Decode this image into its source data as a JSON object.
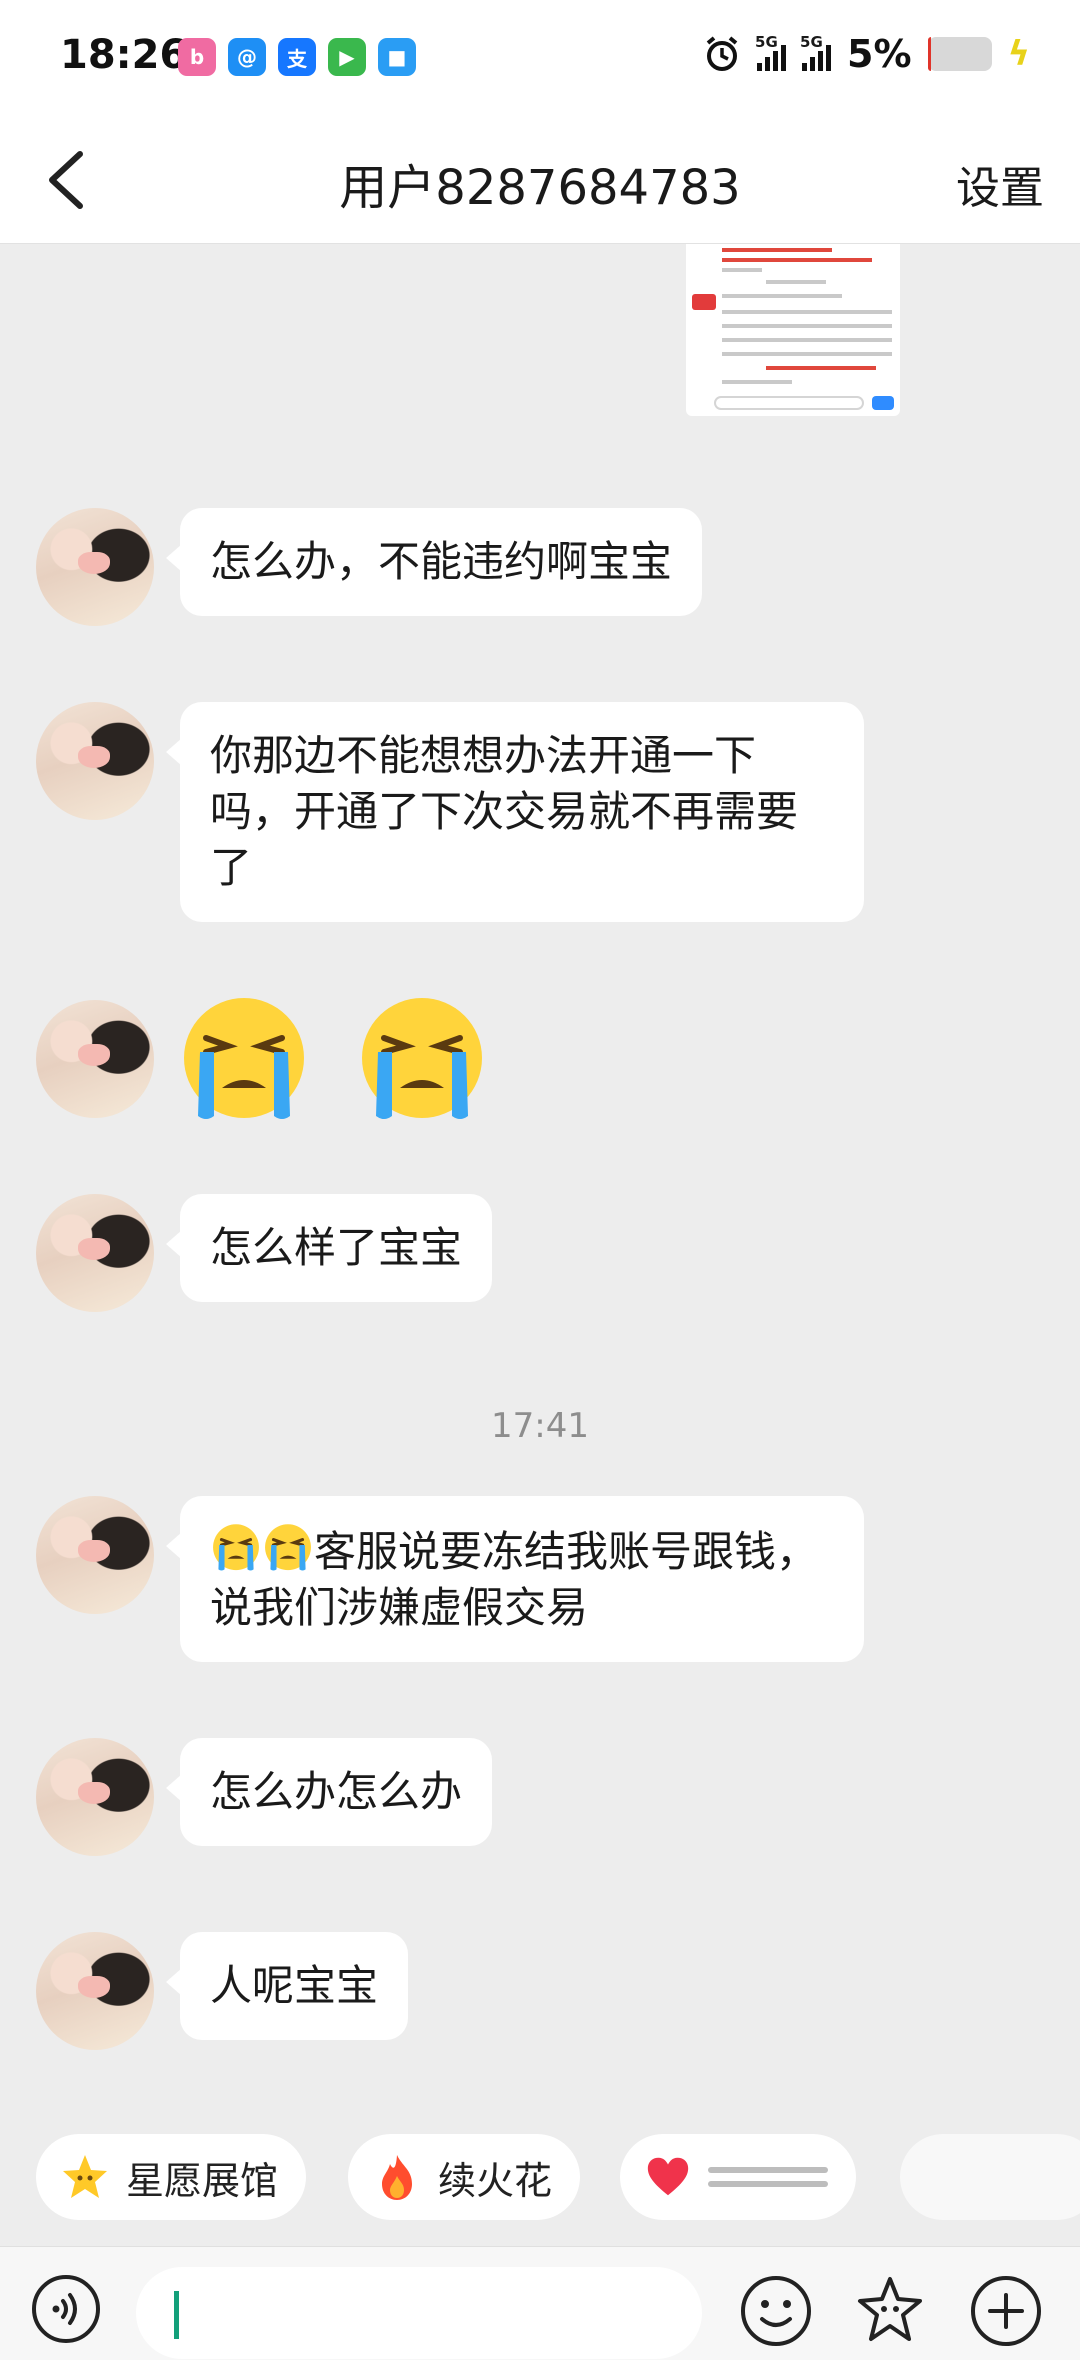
{
  "status_bar": {
    "time": "18:26",
    "apps": [
      {
        "name": "app-bilibili-icon",
        "glyph": "b",
        "color": "#f06ba2"
      },
      {
        "name": "app-orbit-icon",
        "glyph": "@",
        "color": "#1e8ff5"
      },
      {
        "name": "app-alipay-icon",
        "glyph": "支",
        "color": "#1677ff"
      },
      {
        "name": "app-video-icon",
        "glyph": "▶",
        "color": "#3ab84d"
      },
      {
        "name": "app-cloud-icon",
        "glyph": "■",
        "color": "#2a9df4"
      }
    ],
    "network_1": "5G",
    "network_2": "5G",
    "battery_percent": "5%",
    "battery_level": 0.05
  },
  "header": {
    "title": "用户8287684783",
    "settings_label": "设置"
  },
  "messages": [
    {
      "type": "text",
      "text": "怎么办，不能违约啊宝宝"
    },
    {
      "type": "text",
      "text": "你那边不能想想办法开通一下吗，开通了下次交易就不再需要了"
    },
    {
      "type": "emoji",
      "emoji": "loudly-crying-face",
      "count": 2
    },
    {
      "type": "text",
      "text": "怎么样了宝宝"
    },
    {
      "type": "time",
      "text": "17:41"
    },
    {
      "type": "text",
      "text": "客服说要冻结我账号跟钱，说我们涉嫌虚假交易",
      "prefix_emoji_count": 2
    },
    {
      "type": "text",
      "text": "怎么办怎么办"
    },
    {
      "type": "text",
      "text": "人呢宝宝"
    }
  ],
  "quick_chips": [
    {
      "label": "星愿展馆",
      "icon": "star-face-icon"
    },
    {
      "label": "续火花",
      "icon": "fire-icon"
    },
    {
      "label": "",
      "icon": "heart-icon"
    }
  ],
  "input_bar": {
    "voice_icon": "voice-icon",
    "emoji_icon": "smiley-icon",
    "sticker_icon": "sticker-star-icon",
    "more_icon": "plus-icon"
  },
  "colors": {
    "background": "#ededed",
    "bubble": "#ffffff",
    "cursor": "#13a07a"
  }
}
